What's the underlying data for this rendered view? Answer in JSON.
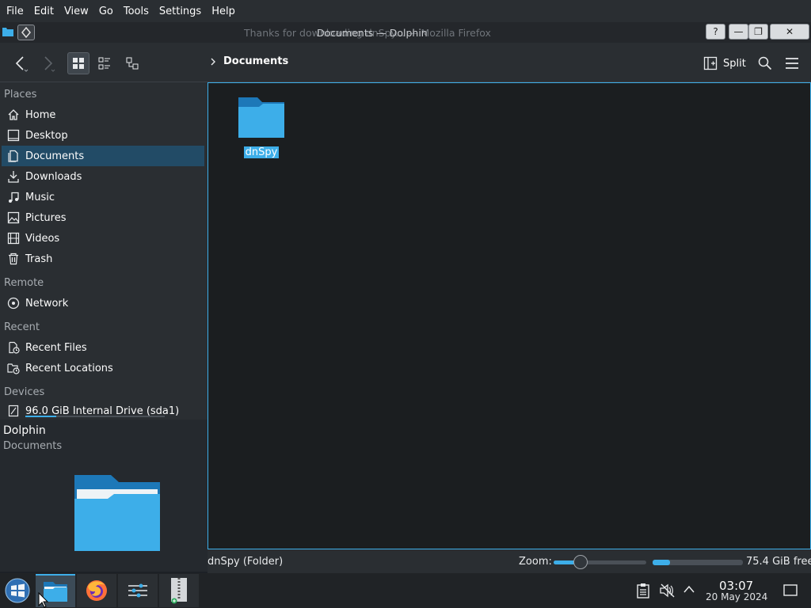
{
  "menubar": {
    "items": [
      "File",
      "Edit",
      "View",
      "Go",
      "Tools",
      "Settings",
      "Help"
    ]
  },
  "titlebar": {
    "background_title": "Thanks for downloading dnSpy... — Mozilla Firefox",
    "title": "Documents — Dolphin",
    "help_label": "?",
    "min_label": "—",
    "max_label": "❐",
    "close_label": "✕"
  },
  "toolbar": {
    "back_icon": "back-arrow-icon",
    "forward_icon": "forward-arrow-icon",
    "view_modes": [
      "icons-view-icon",
      "compact-view-icon",
      "details-view-icon"
    ],
    "breadcrumb": "Documents",
    "split_label": "Split"
  },
  "sidebar": {
    "sections": {
      "places": "Places",
      "remote": "Remote",
      "recent": "Recent",
      "devices": "Devices"
    },
    "places": [
      {
        "label": "Home",
        "icon": "home-icon"
      },
      {
        "label": "Desktop",
        "icon": "desktop-icon"
      },
      {
        "label": "Documents",
        "icon": "documents-icon",
        "selected": true
      },
      {
        "label": "Downloads",
        "icon": "downloads-icon"
      },
      {
        "label": "Music",
        "icon": "music-icon"
      },
      {
        "label": "Pictures",
        "icon": "pictures-icon"
      },
      {
        "label": "Videos",
        "icon": "videos-icon"
      },
      {
        "label": "Trash",
        "icon": "trash-icon"
      }
    ],
    "remote": [
      {
        "label": "Network",
        "icon": "network-icon"
      }
    ],
    "recent": [
      {
        "label": "Recent Files",
        "icon": "recent-files-icon"
      },
      {
        "label": "Recent Locations",
        "icon": "recent-locations-icon"
      }
    ],
    "devices": [
      {
        "label": "96.0 GiB Internal Drive (sda1)",
        "icon": "drive-icon",
        "used_fraction": 0.22
      }
    ]
  },
  "preview": {
    "title": "Dolphin",
    "subtitle": "Documents"
  },
  "content": {
    "items": [
      {
        "name": "dnSpy",
        "type": "folder",
        "selected": true
      }
    ]
  },
  "statusbar": {
    "status": "dnSpy (Folder)",
    "zoom_label": "Zoom:",
    "zoom_fraction": 0.29,
    "space_used_fraction": 0.19,
    "free_space": "75.4 GiB free"
  },
  "taskbar": {
    "apps": [
      "start-menu-icon",
      "dolphin-icon",
      "firefox-icon",
      "settings-icon",
      "archive-icon"
    ],
    "clock_time": "03:07",
    "clock_date": "20 May 2024"
  },
  "colors": {
    "accent": "#3daee9",
    "selection": "#224b66",
    "background": "#1b1e20"
  }
}
